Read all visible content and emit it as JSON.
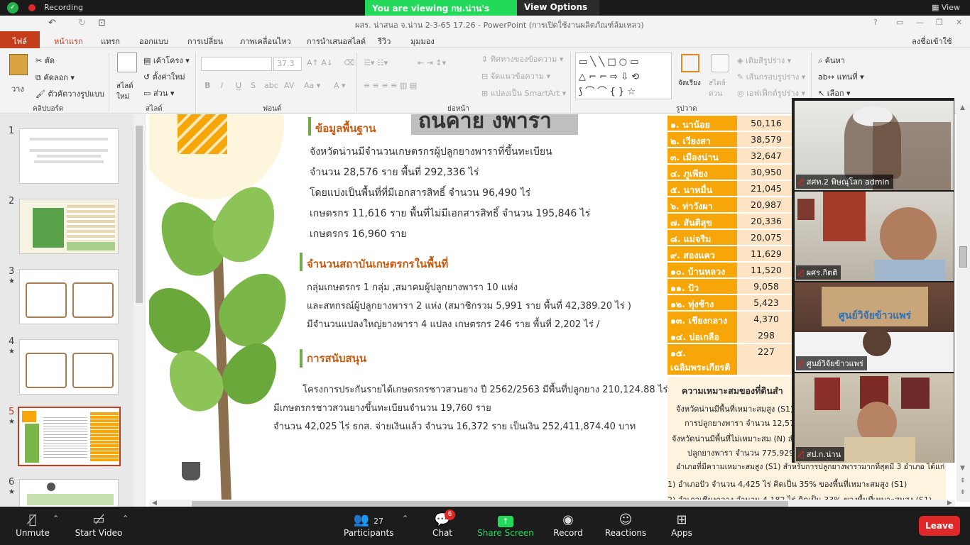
{
  "zoom_top": {
    "recording_label": "Recording",
    "view_label": "View"
  },
  "share_banner": {
    "viewing": "You are viewing กษ.น่าน's screen",
    "options": "View Options"
  },
  "ppt": {
    "title": "ผสร. น่าสนอ จ.น่าน 2-3-65 17.26 - PowerPoint (การเปิดใช้งานผลิตภัณฑ์ล้มเหลว)",
    "signin": "ลงชื่อเข้าใช้"
  },
  "tabs": [
    "ไฟล์",
    "หน้าแรก",
    "แทรก",
    "ออกแบบ",
    "การเปลี่ยน",
    "ภาพเคลื่อนไหว",
    "การนำเสนอสไลด์",
    "รีวิว",
    "มุมมอง"
  ],
  "ribbon": {
    "paste": "วาง",
    "cut": "ตัด",
    "copy": "คัดลอก",
    "format_painter": "ตัวคัดวางรูปแบบ",
    "new_slide": "สไลด์ใหม่",
    "layout": "เค้าโครง",
    "reset": "ตั้งค่าใหม่",
    "section": "ส่วน",
    "font_size": "37.3",
    "text_direction": "ทิศทางของข้อความ",
    "align_text": "จัดแนวข้อความ",
    "smartart": "แปลงเป็น SmartArt",
    "arrange": "จัดเรียง",
    "quick_styles": "สไตล์ด่วน",
    "shape_fill": "เติมสีรูปร่าง",
    "shape_outline": "เส้นกรอบรูปร่าง",
    "shape_effects": "เอฟเฟ็กต์รูปร่าง",
    "find": "ค้นหา",
    "replace": "แทนที่",
    "select": "เลือก",
    "groups": {
      "clipboard": "คลิปบอร์ด",
      "slides": "สไลด์",
      "font": "ฟอนต์",
      "paragraph": "ย่อหน้า",
      "drawing": "รูปวาด"
    }
  },
  "thumbnails": [
    {
      "num": "1",
      "star": ""
    },
    {
      "num": "2",
      "star": ""
    },
    {
      "num": "3",
      "star": "★"
    },
    {
      "num": "4",
      "star": "★"
    },
    {
      "num": "5",
      "star": "★"
    },
    {
      "num": "6",
      "star": "★"
    }
  ],
  "slide": {
    "banner_partial": "ถนคาย งพารา",
    "h1": "ข้อมูลพื้นฐาน",
    "p1": [
      "จังหวัดน่านมีจำนวนเกษตรกรผู้ปลูกยางพาราที่ขึ้นทะเบียน",
      "จำนวน 28,576 ราย พื้นที่ 292,336 ไร่",
      "โดยแบ่งเป็นพื้นที่ที่มีเอกสารสิทธิ์ จำนวน 96,490 ไร่",
      "เกษตรกร 11,616 ราย พื้นที่ไม่มีเอกสารสิทธิ์ จำนวน 195,846 ไร่",
      "เกษตรกร 16,960 ราย"
    ],
    "h2": "จำนวนสถาบันเกษตรกรในพื้นที่",
    "p2": [
      "กลุ่มเกษตรกร 1 กลุ่ม ,สมาคมผู้ปลูกยางพารา 10 แห่ง",
      "และสหกรณ์ผู้ปลูกยางพารา 2 แห่ง (สมาชิกรวม 5,991 ราย พื้นที่ 42,389.20 ไร่ )",
      "มีจำนวนแปลงใหญ่ยางพารา  4 แปลง เกษตรกร 246 ราย พื้นที่ 2,202 ไร่ /"
    ],
    "h3": "การสนับสนุน",
    "p3": [
      "โครงการประกันรายได้เกษตรกรชาวสวนยาง ปี 2562/2563 มีพื้นที่ปลูกยาง 210,124.88 ไร่",
      "มีเกษตรกรชาวสวนยางขึ้นทะเบียนจำนวน 19,760 ราย",
      "จำนวน 42,025 ไร่  ธกส. จ่ายเงินแล้ว จำนวน 16,372  ราย เป็นเงิน 252,411,874.40 บาท"
    ],
    "suit_title": "ความเหมาะสมของที่ดินสำ",
    "suit_lines": [
      "จังหวัดน่านมีพื้นที่เหมาะสมสูง (S1) สำ",
      "การปลูกยางพารา จำนวน 12,574",
      "จังหวัดน่านมีพื้นที่ไม่เหมาะสม (N) สำห",
      "ปลูกยางพารา จำนวน 775,929",
      "อำเภอที่มีความเหมาะสมสูง (S1) สำหรับการปลูกยางพารามากที่สุดมี 3 อำเภอ ได้แก่",
      "1) อำเภอปัว จำนวน 4,425 ไร่ คิดเป็น 35% ของพื้นที่เหมาะสมสูง (S1)",
      "2) อำเภอเชียงกลาง จำนวน 4,182 ไร่ คิดเป็น 33% ของพื้นที่เหมาะสมสูง (S1)"
    ]
  },
  "district_table": [
    {
      "name": "๑. นาน้อย",
      "value": "50,116"
    },
    {
      "name": "๒. เวียงสา",
      "value": "38,579"
    },
    {
      "name": "๓. เมืองน่าน",
      "value": "32,647"
    },
    {
      "name": "๔. ภูเพียง",
      "value": "30,950"
    },
    {
      "name": "๕. นาหมื่น",
      "value": "21,045"
    },
    {
      "name": "๖. ท่าวังผา",
      "value": "20,987"
    },
    {
      "name": "๗. สันติสุข",
      "value": "20,336"
    },
    {
      "name": "๘. แม่จริม",
      "value": "20,075"
    },
    {
      "name": "๙. สองแคว",
      "value": "11,629"
    },
    {
      "name": "๑๐. บ้านหลวง",
      "value": "11,520"
    },
    {
      "name": "๑๑. ปัว",
      "value": "9,058"
    },
    {
      "name": "๑๒. ทุ่งช้าง",
      "value": "5,423"
    },
    {
      "name": "๑๓. เชียงกลาง",
      "value": "4,370"
    },
    {
      "name": "๑๔. บ่อเกลือ",
      "value": "298"
    },
    {
      "name": "๑๕. เฉลิมพระเกียรติ",
      "value": "227"
    }
  ],
  "videos": [
    {
      "name": "สศท.2 พิษณุโลก admin"
    },
    {
      "name": "ผศร.กิตติ"
    },
    {
      "name": "ศูนย์วิจัยข้าวแพร่"
    },
    {
      "name": "สป.ก.น่าน"
    }
  ],
  "video_banner_text": "ศูนย์วิจัยข้าวแพร่",
  "zoom_bar": {
    "unmute": "Unmute",
    "start_video": "Start Video",
    "participants": "Participants",
    "participants_count": "27",
    "chat": "Chat",
    "chat_badge": "6",
    "share": "Share Screen",
    "record": "Record",
    "reactions": "Reactions",
    "apps": "Apps",
    "leave": "Leave"
  },
  "colors": {
    "accent_orange": "#c55a11",
    "table_orange": "#f6a609",
    "share_green": "#23d959",
    "leave_red": "#e02828"
  }
}
